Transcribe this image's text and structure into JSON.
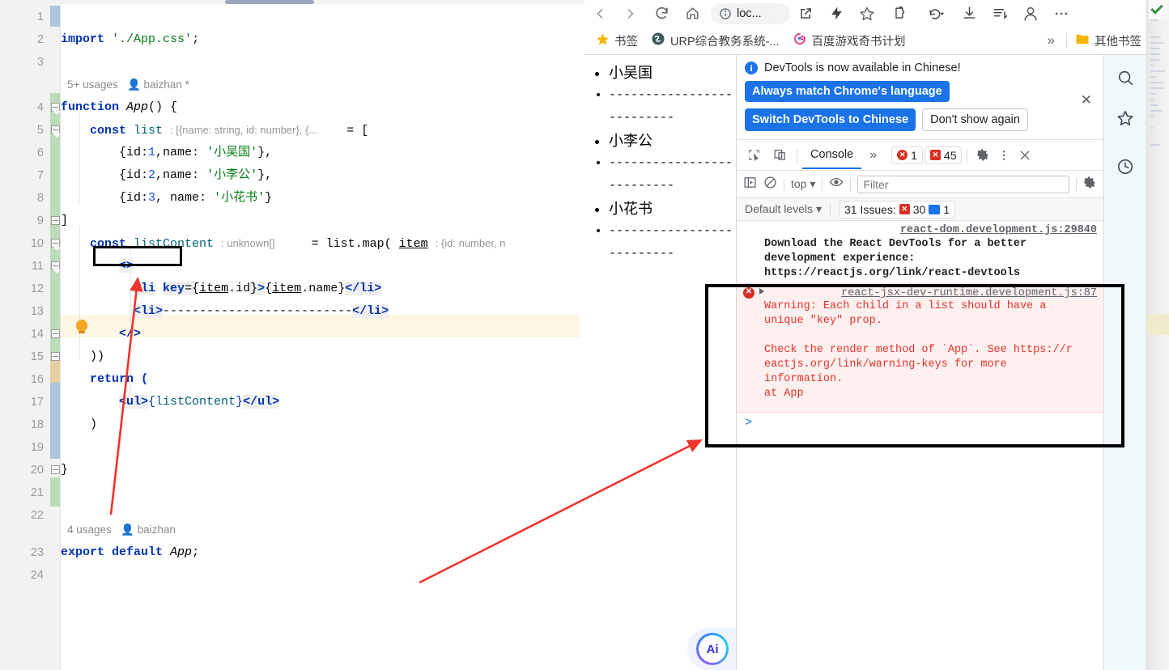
{
  "ide": {
    "line_numbers": [
      "1",
      "2",
      "3",
      "4",
      "5",
      "6",
      "7",
      "8",
      "9",
      "10",
      "11",
      "12",
      "13",
      "14",
      "15",
      "16",
      "17",
      "18",
      "19",
      "20",
      "21",
      "22",
      "23",
      "24"
    ],
    "usages_app": "5+ usages",
    "author_app": "baizhan *",
    "usages_export": "4 usages",
    "author_export": "baizhan",
    "code": {
      "l2_import_kw": "import",
      "l2_path": "'./App.css'",
      "l2_semi": ";",
      "l4_function_kw": "function",
      "l4_name": "App",
      "l4_rest": "() {",
      "l5_const": "const",
      "l5_name": "list",
      "l5_hint": ": [{name: string, id: number}, {...",
      "l5_assign": "= [",
      "l6": "{id:1,name: '小吴国'},",
      "l7": "{id:2,name: '小李公'},",
      "l8": "{id:3, name: '小花书'}",
      "l9": "]",
      "l10_const": "const",
      "l10_name": "listContent",
      "l10_hint": ": unknown[]",
      "l10_assign": "= list.map(",
      "l10_item": "item",
      "l10_hint2": ": {id: number, n",
      "l11": "<>",
      "l12": "<li key={item.id}>{item.name}</li>",
      "l13": "<li>--------------------------</li>",
      "l14": "</>",
      "l15": "))",
      "l16": "return (",
      "l17": "<ul>{listContent}</ul>",
      "l18": ")",
      "l20": "}",
      "l23_export": "export default",
      "l23_name": "App",
      "l23_semi": ";"
    }
  },
  "browser": {
    "toolbar": {
      "back_icon": "back-arrow-icon",
      "forward_icon": "forward-arrow-icon",
      "reload_icon": "reload-icon",
      "home_icon": "home-icon",
      "site_info_icon": "info-circle-icon",
      "url_text": "loc...",
      "share_icon": "share-icon",
      "lightning_icon": "lightning-icon",
      "bookmark_icon": "star-icon",
      "extensions_icon": "puzzle-icon",
      "history_back_icon": "history-arrow-icon",
      "download_icon": "download-icon",
      "reading_list_icon": "reading-list-icon",
      "profile_icon": "profile-avatar-icon",
      "menu_icon": "three-dots-menu-icon"
    },
    "bookmarks": [
      {
        "label": "书签",
        "icon": "star-folder-icon"
      },
      {
        "label": "URP综合教务系统-...",
        "icon": "urp-icon"
      },
      {
        "label": "百度游戏奇书计划",
        "icon": "baidu-icon"
      }
    ],
    "bookmarks_overflow": "»",
    "other_bookmarks": "其他书签"
  },
  "page": {
    "items": [
      {
        "text": "小吴国",
        "type": "name"
      },
      {
        "text": "--------------------------",
        "type": "dash"
      },
      {
        "text": "小李公",
        "type": "name"
      },
      {
        "text": "--------------------------",
        "type": "dash"
      },
      {
        "text": "小花书",
        "type": "name"
      },
      {
        "text": "--------------------------",
        "type": "dash"
      }
    ],
    "ai_button_label": "Ai"
  },
  "devtools": {
    "banner": {
      "title": "DevTools is now available in Chinese!",
      "primary_btn": "Always match Chrome's language",
      "secondary_btn": "Switch DevTools to Chinese",
      "tertiary_btn": "Don't show again",
      "close_icon": "close-icon"
    },
    "tabs": {
      "inspect_icon": "inspect-element-icon",
      "device_icon": "device-toolbar-icon",
      "active_tab": "Console",
      "more_tabs": "»",
      "error_count": "1",
      "issue_count": "45",
      "settings_icon": "gear-icon",
      "more_icon": "vertical-dots-icon",
      "close_icon": "close-icon"
    },
    "filterbar": {
      "sidebar_icon": "console-sidebar-icon",
      "clear_icon": "clear-console-icon",
      "context": "top",
      "eye_icon": "live-expression-icon",
      "filter_placeholder": "Filter",
      "settings_icon": "gear-icon"
    },
    "levels": {
      "level_label": "Default levels",
      "issues_label": "31 Issues:",
      "issues_errors": "30",
      "issues_info": "1"
    },
    "messages": [
      {
        "source": "react-dom.development.js:29840",
        "text": "Download the React DevTools for a better development experience: https://reactjs.org/link/react-devtools",
        "level": "warn"
      },
      {
        "source": "react-jsx-dev-runtime.development.js:87",
        "line1": "Warning: Each child in a list should have a",
        "line2": "unique \"key\" prop.",
        "line3": "Check the render method of `App`. See https://r",
        "line4": "eactjs.org/link/warning-keys for more",
        "line5": "information.",
        "line6": "    at App",
        "level": "error"
      }
    ],
    "prompt": ">"
  },
  "rail": {
    "search_icon": "search-icon",
    "favorite_icon": "star-icon",
    "history_icon": "clock-icon"
  },
  "colors": {
    "accent_blue": "#1a73e8",
    "error_red": "#d93025",
    "annotation_red": "#f0342c",
    "annotation_black": "#000000",
    "keyword_blue": "#0033b3",
    "string_green": "#067d17"
  }
}
